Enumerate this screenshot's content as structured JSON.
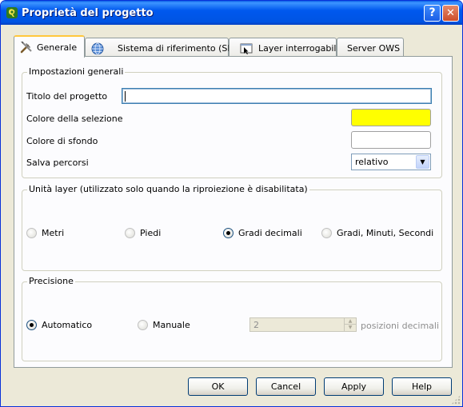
{
  "window": {
    "title": "Proprietà del progetto",
    "help_button": "?",
    "close_button": "✕"
  },
  "tabs": [
    {
      "label": "Generale",
      "icon": "tools-icon",
      "active": true
    },
    {
      "label": "Sistema di riferimento (SR)",
      "icon": "globe-icon",
      "active": false
    },
    {
      "label": "Layer interrogabili",
      "icon": "identify-icon",
      "active": false
    },
    {
      "label": "Server OWS",
      "icon": "",
      "active": false
    }
  ],
  "general_settings": {
    "group_title": "Impostazioni generali",
    "project_title_label": "Titolo del progetto",
    "project_title_value": "",
    "selection_color_label": "Colore della selezione",
    "selection_color": "#ffff00",
    "background_color_label": "Colore di sfondo",
    "background_color": "#ffffff",
    "save_paths_label": "Salva percorsi",
    "save_paths_value": "relativo"
  },
  "layer_units": {
    "group_title": "Unità layer (utilizzato solo quando la riproiezione è disabilitata)",
    "options": [
      {
        "label": "Metri",
        "checked": false
      },
      {
        "label": "Piedi",
        "checked": false
      },
      {
        "label": "Gradi decimali",
        "checked": true
      },
      {
        "label": "Gradi, Minuti, Secondi",
        "checked": false
      }
    ]
  },
  "precision": {
    "group_title": "Precisione",
    "automatic_label": "Automatico",
    "automatic_checked": true,
    "manual_label": "Manuale",
    "manual_checked": false,
    "decimal_places_value": "2",
    "decimal_places_suffix": "posizioni decimali"
  },
  "buttons": {
    "ok": "OK",
    "cancel": "Cancel",
    "apply": "Apply",
    "help": "Help"
  }
}
